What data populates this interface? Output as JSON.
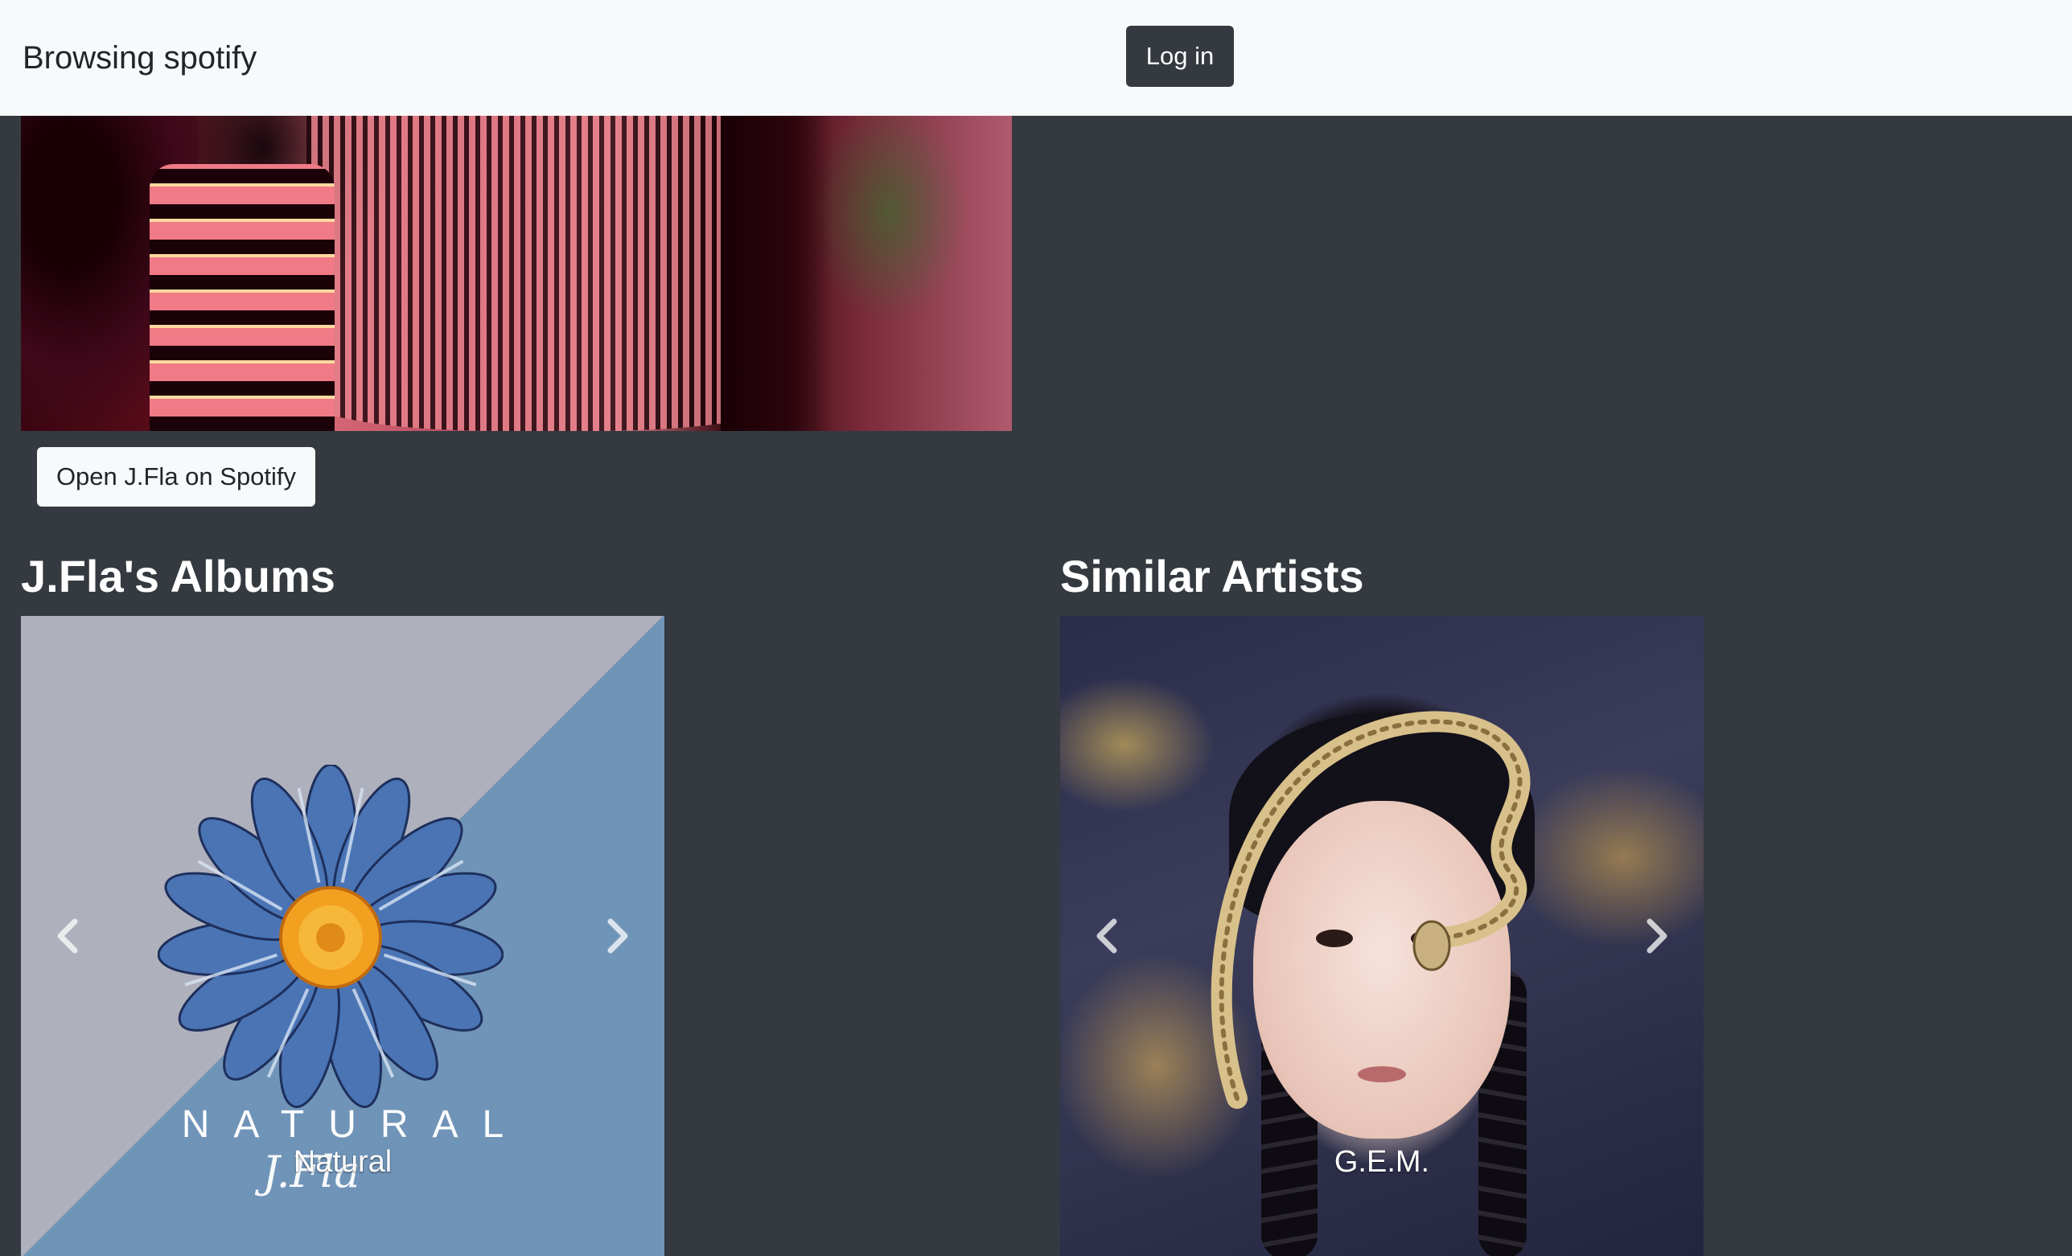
{
  "navbar": {
    "brand": "Browsing spotify",
    "login_label": "Log in"
  },
  "artist": {
    "open_label": "Open J.Fla on Spotify"
  },
  "albums": {
    "title": "J.Fla's Albums",
    "current": {
      "caption": "Natural",
      "cover_text": "NATURAL",
      "cover_signature": "J.Fla"
    }
  },
  "similar": {
    "title": "Similar Artists",
    "current": {
      "caption": "G.E.M."
    }
  },
  "icons": {
    "prev": "chevron-left-icon",
    "next": "chevron-right-icon"
  },
  "colors": {
    "page_background": "#343a40",
    "navbar_background": "#f8f9fa",
    "login_button": "#343a40",
    "open_button": "#f8f9fa"
  }
}
